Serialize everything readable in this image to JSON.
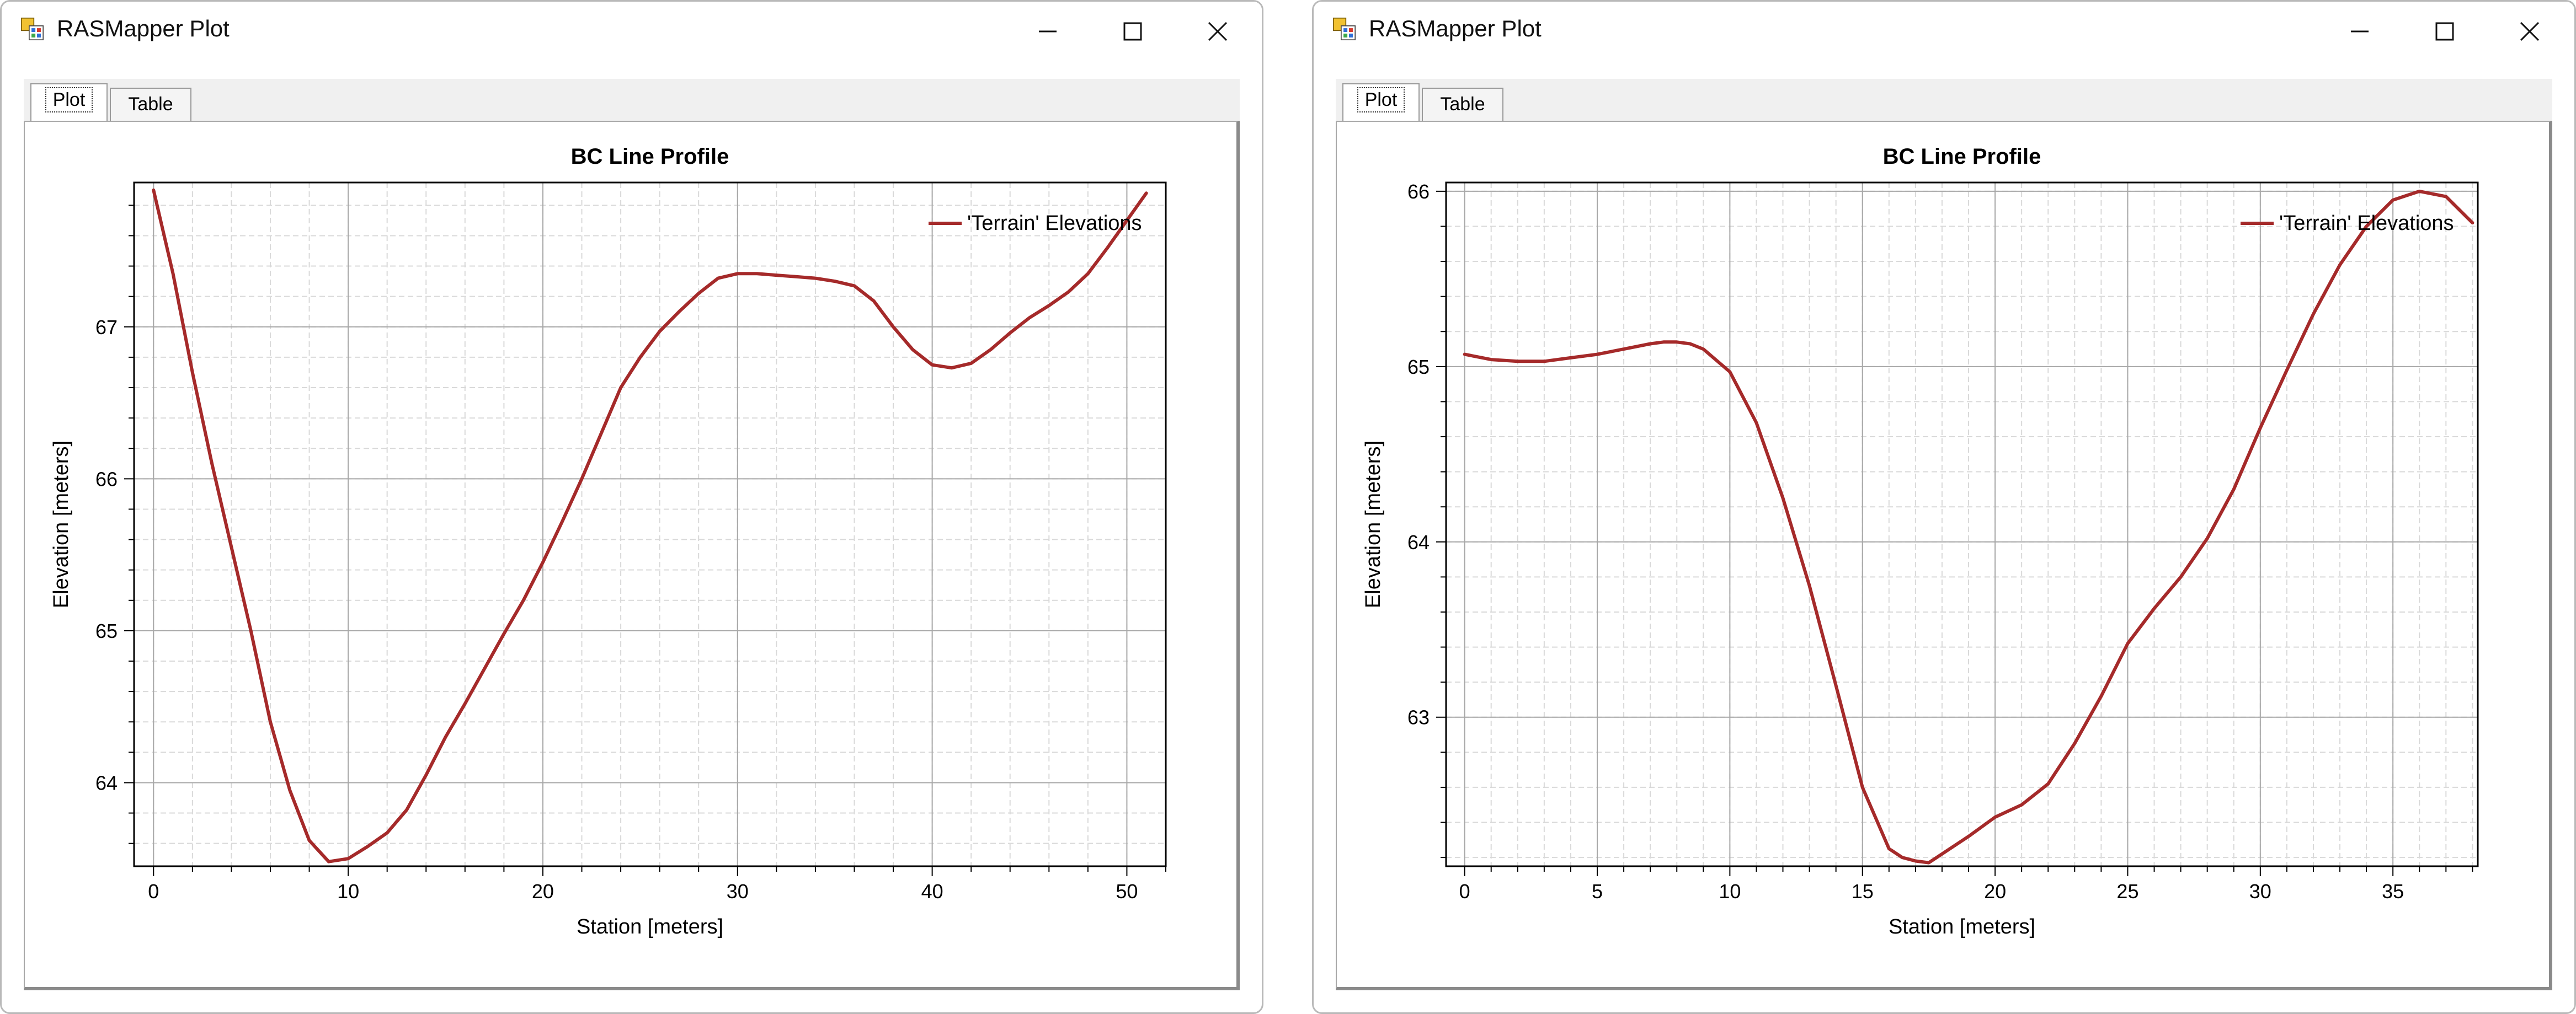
{
  "windows": [
    {
      "title": "RASMapper Plot",
      "tabs": [
        {
          "label": "Plot",
          "active": true
        },
        {
          "label": "Table",
          "active": false
        }
      ],
      "chart_data": {
        "type": "line",
        "title": "BC Line Profile",
        "xlabel": "Station [meters]",
        "ylabel": "Elevation [meters]",
        "xlim": [
          -1,
          52
        ],
        "ylim": [
          63.45,
          67.95
        ],
        "xticks": [
          0,
          10,
          20,
          30,
          40,
          50
        ],
        "yticks": [
          64,
          65,
          66,
          67
        ],
        "grid": true,
        "legend_position": "top-right",
        "series": [
          {
            "name": "'Terrain' Elevations",
            "color": "#a52a2a",
            "x": [
              0,
              1,
              2,
              3,
              4,
              5,
              6,
              7,
              8,
              9,
              10,
              11,
              12,
              13,
              14,
              15,
              16,
              17,
              18,
              19,
              20,
              21,
              22,
              23,
              24,
              25,
              26,
              27,
              28,
              29,
              30,
              31,
              32,
              33,
              34,
              35,
              36,
              37,
              38,
              39,
              40,
              41,
              42,
              43,
              44,
              45,
              46,
              47,
              48,
              49,
              50,
              51
            ],
            "y": [
              67.9,
              67.35,
              66.7,
              66.1,
              65.55,
              65.0,
              64.4,
              63.95,
              63.62,
              63.48,
              63.5,
              63.58,
              63.67,
              63.82,
              64.05,
              64.3,
              64.52,
              64.75,
              64.98,
              65.2,
              65.45,
              65.72,
              66.0,
              66.3,
              66.6,
              66.8,
              66.97,
              67.1,
              67.22,
              67.32,
              67.35,
              67.35,
              67.34,
              67.33,
              67.32,
              67.3,
              67.27,
              67.17,
              67.0,
              66.85,
              66.75,
              66.73,
              66.76,
              66.85,
              66.96,
              67.06,
              67.14,
              67.23,
              67.35,
              67.52,
              67.7,
              67.88
            ]
          }
        ]
      }
    },
    {
      "title": "RASMapper Plot",
      "tabs": [
        {
          "label": "Plot",
          "active": true
        },
        {
          "label": "Table",
          "active": false
        }
      ],
      "chart_data": {
        "type": "line",
        "title": "BC Line Profile",
        "xlabel": "Station [meters]",
        "ylabel": "Elevation [meters]",
        "xlim": [
          -0.7,
          38.2
        ],
        "ylim": [
          62.15,
          66.05
        ],
        "xticks": [
          0,
          5,
          10,
          15,
          20,
          25,
          30,
          35
        ],
        "yticks": [
          63,
          64,
          65,
          66
        ],
        "grid": true,
        "legend_position": "top-right",
        "series": [
          {
            "name": "'Terrain' Elevations",
            "color": "#a52a2a",
            "x": [
              0,
              1,
              2,
              3,
              4,
              5,
              6,
              7,
              7.5,
              8,
              8.5,
              9,
              10,
              11,
              12,
              13,
              14,
              15,
              16,
              16.5,
              17,
              17.5,
              18,
              19,
              20,
              21,
              22,
              23,
              24,
              25,
              26,
              27,
              28,
              29,
              30,
              31,
              32,
              33,
              34,
              35,
              36,
              37,
              38
            ],
            "y": [
              65.07,
              65.04,
              65.03,
              65.03,
              65.05,
              65.07,
              65.1,
              65.13,
              65.14,
              65.14,
              65.13,
              65.1,
              64.97,
              64.68,
              64.25,
              63.75,
              63.18,
              62.6,
              62.25,
              62.2,
              62.18,
              62.17,
              62.22,
              62.32,
              62.43,
              62.5,
              62.62,
              62.85,
              63.12,
              63.42,
              63.62,
              63.8,
              64.02,
              64.3,
              64.65,
              64.98,
              65.3,
              65.58,
              65.8,
              65.95,
              66.0,
              65.97,
              65.82
            ]
          }
        ]
      }
    }
  ]
}
